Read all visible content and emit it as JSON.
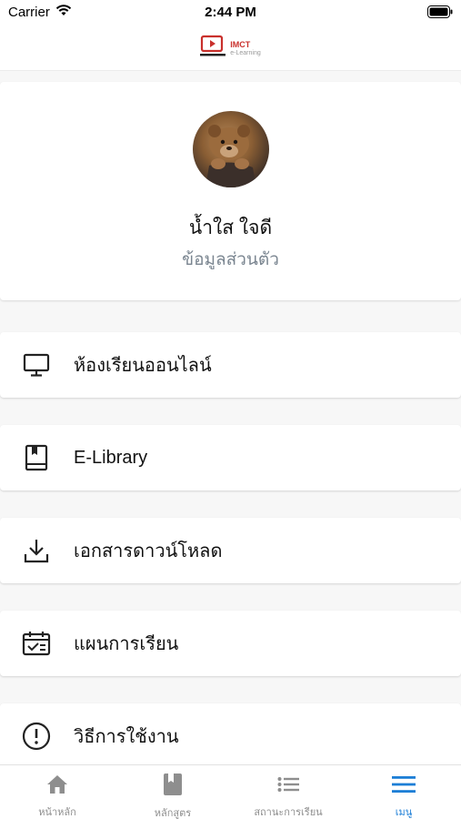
{
  "status_bar": {
    "carrier": "Carrier",
    "time": "2:44 PM"
  },
  "header": {
    "logo_main": "IMCT",
    "logo_sub": "e-Learning",
    "brand_color": "#c9302c"
  },
  "profile": {
    "name": "น้ำใส ใจดี",
    "link_label": "ข้อมูลส่วนตัว"
  },
  "menu": {
    "items": [
      {
        "label": "ห้องเรียนออนไลน์",
        "icon": "monitor-icon"
      },
      {
        "label": "E-Library",
        "icon": "book-icon"
      },
      {
        "label": "เอกสารดาวน์โหลด",
        "icon": "download-icon"
      },
      {
        "label": "แผนการเรียน",
        "icon": "calendar-check-icon"
      },
      {
        "label": "วิธีการใช้งาน",
        "icon": "info-circle-icon"
      }
    ]
  },
  "tabs": {
    "items": [
      {
        "label": "หน้าหลัก",
        "icon": "home-icon"
      },
      {
        "label": "หลักสูตร",
        "icon": "book-icon"
      },
      {
        "label": "สถานะการเรียน",
        "icon": "list-icon"
      },
      {
        "label": "เมนู",
        "icon": "menu-icon"
      }
    ],
    "active_index": 3,
    "active_color": "#1c7ed6",
    "inactive_color": "#8e8e8e"
  }
}
